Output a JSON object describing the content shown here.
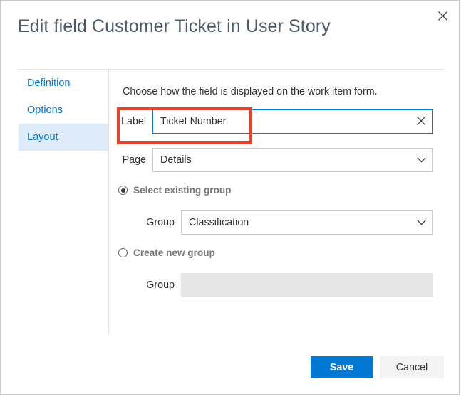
{
  "dialog": {
    "title": "Edit field Customer Ticket in User Story",
    "close_icon": "close-icon"
  },
  "sidebar": {
    "items": [
      {
        "label": "Definition",
        "selected": false
      },
      {
        "label": "Options",
        "selected": false
      },
      {
        "label": "Layout",
        "selected": true
      }
    ]
  },
  "main": {
    "intro": "Choose how the field is displayed on the work item form.",
    "label_field": {
      "label": "Label",
      "value": "Ticket Number",
      "clear_icon": "close-icon",
      "focused": true
    },
    "page_field": {
      "label": "Page",
      "value": "Details",
      "chevron_icon": "chevron-down-icon"
    },
    "existing_group": {
      "radio_label": "Select existing group",
      "selected": true,
      "label": "Group",
      "value": "Classification",
      "chevron_icon": "chevron-down-icon"
    },
    "new_group": {
      "radio_label": "Create new group",
      "selected": false,
      "label": "Group",
      "value": "",
      "disabled": true
    }
  },
  "footer": {
    "save_label": "Save",
    "cancel_label": "Cancel"
  },
  "colors": {
    "accent": "#0078d4",
    "annotation": "#e8412c",
    "selected_nav_bg": "#deecf9",
    "title_text": "#4a5a6a",
    "disabled_bg": "#e6e6e6"
  }
}
